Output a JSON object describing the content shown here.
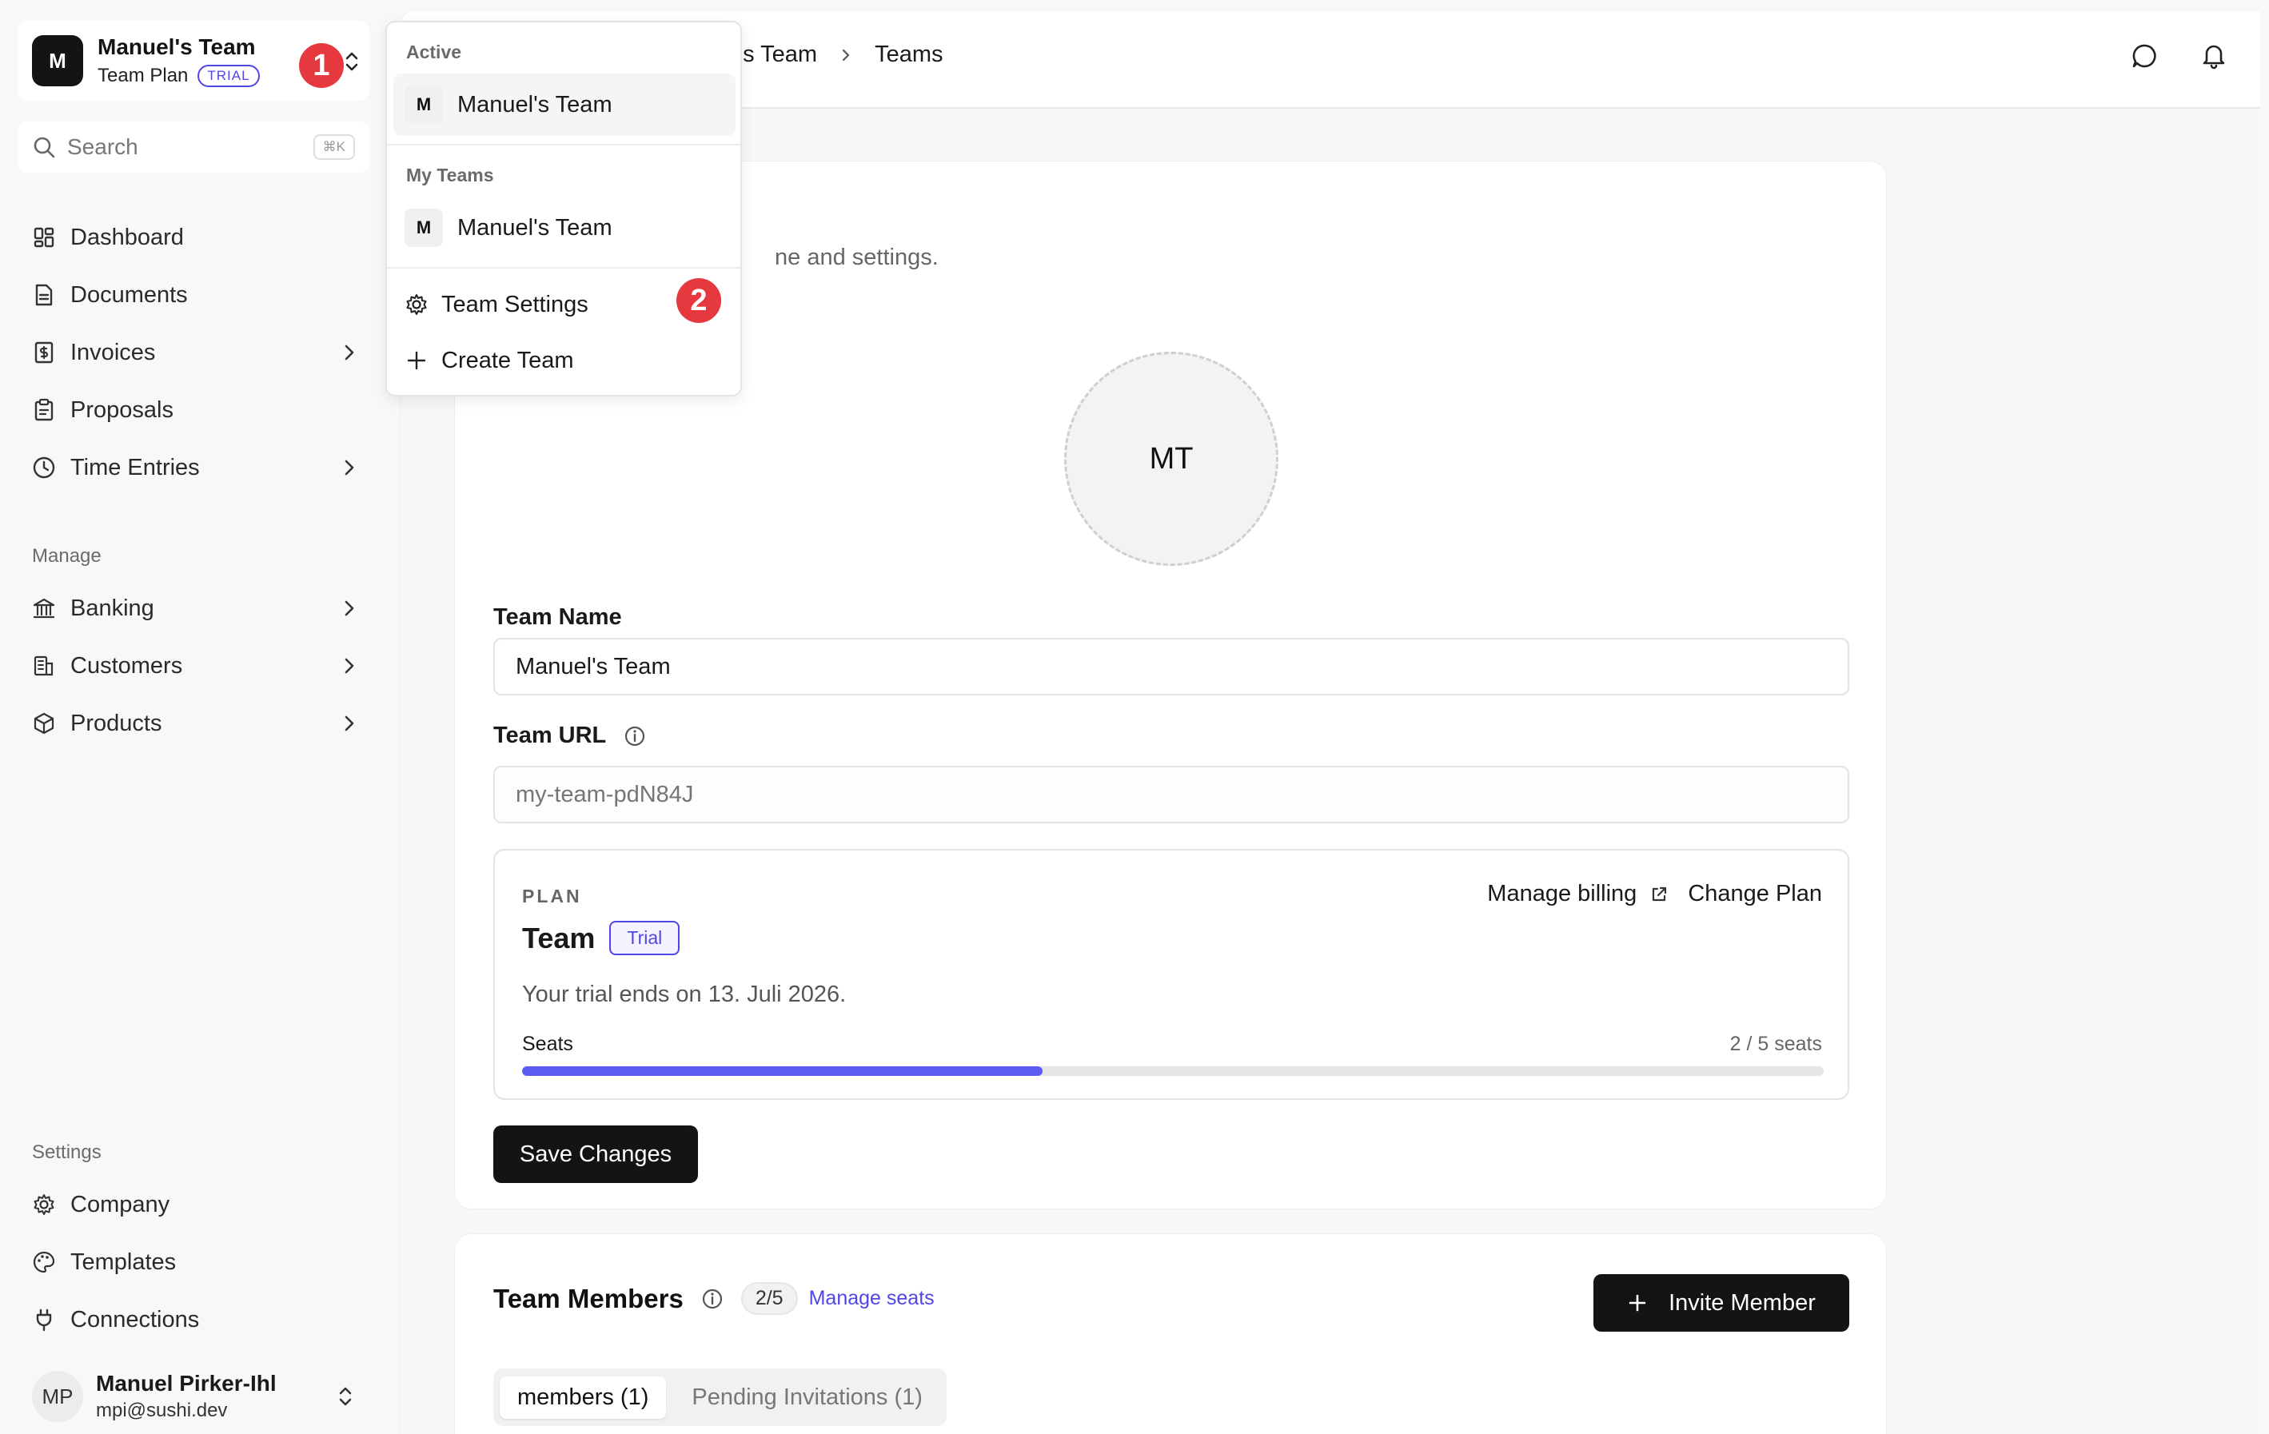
{
  "team_switcher": {
    "avatar_letter": "M",
    "team_name": "Manuel's Team",
    "plan_label": "Team Plan",
    "trial_badge": "TRIAL",
    "step_one": "1"
  },
  "search": {
    "placeholder": "Search",
    "shortcut": "⌘K"
  },
  "nav": {
    "main_items": [
      {
        "label": "Dashboard",
        "icon": "dashboard-icon",
        "has_children": false
      },
      {
        "label": "Documents",
        "icon": "document-icon",
        "has_children": false
      },
      {
        "label": "Invoices",
        "icon": "invoice-icon",
        "has_children": true
      },
      {
        "label": "Proposals",
        "icon": "clipboard-icon",
        "has_children": false
      },
      {
        "label": "Time Entries",
        "icon": "clock-icon",
        "has_children": true
      }
    ],
    "manage_label": "Manage",
    "manage_items": [
      {
        "label": "Banking",
        "icon": "bank-icon",
        "has_children": true
      },
      {
        "label": "Customers",
        "icon": "building-icon",
        "has_children": true
      },
      {
        "label": "Products",
        "icon": "box-icon",
        "has_children": true
      }
    ],
    "settings_label": "Settings",
    "settings_items": [
      {
        "label": "Company",
        "icon": "gear-icon"
      },
      {
        "label": "Templates",
        "icon": "palette-icon"
      },
      {
        "label": "Connections",
        "icon": "plug-icon"
      }
    ]
  },
  "user": {
    "initials": "MP",
    "name": "Manuel Pirker-Ihl",
    "email": "mpi@sushi.dev"
  },
  "breadcrumb": {
    "parent": "el's Team",
    "current": "Teams"
  },
  "team_card": {
    "description": "ne and settings.",
    "logo_initials": "MT",
    "team_name_label": "Team Name",
    "team_name_value": "Manuel's Team",
    "team_url_label": "Team URL",
    "team_url_placeholder": "my-team-pdN84J",
    "plan": {
      "kicker": "PLAN",
      "name": "Team",
      "badge": "Trial",
      "manage_billing": "Manage billing",
      "change_plan": "Change Plan",
      "trial_text": "Your trial ends on 13. Juli 2026.",
      "seats_label": "Seats",
      "seats_count": "2 / 5 seats",
      "seats_used": 2,
      "seats_total": 5,
      "accent_color": "#5b5bf0"
    },
    "save_button": "Save Changes"
  },
  "members_card": {
    "title": "Team Members",
    "count": "2/5",
    "manage_seats": "Manage seats",
    "invite_button": "Invite Member",
    "tabs": [
      {
        "label": "members (1)",
        "active": true
      },
      {
        "label": "Pending Invitations (1)",
        "active": false
      }
    ]
  },
  "dropdown": {
    "active_heading": "Active",
    "active_team": {
      "letter": "M",
      "name": "Manuel's Team"
    },
    "my_teams_heading": "My Teams",
    "my_teams": [
      {
        "letter": "M",
        "name": "Manuel's Team"
      }
    ],
    "team_settings": "Team Settings",
    "create_team": "Create Team",
    "step_two": "2"
  },
  "colors": {
    "accent": "#4f46e5",
    "step_badge": "#e5393f",
    "dark_button": "#141414"
  }
}
